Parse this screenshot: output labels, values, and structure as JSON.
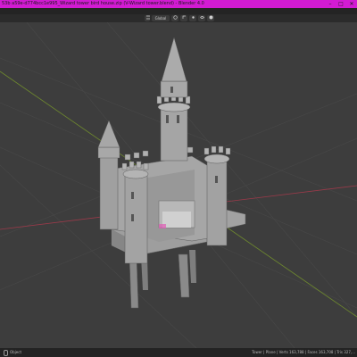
{
  "window": {
    "title": "53b a59e-d774bcc1e995_Wizard tower bird house.zip (V-Wizard tower.blend) - Blender 4.0",
    "controls": [
      "–",
      "□",
      "✕"
    ]
  },
  "header": {
    "view_mode": "Global",
    "icons": [
      "orientation-icon",
      "snap-icon",
      "proportional-icon",
      "overlay-icon",
      "shading-icon"
    ]
  },
  "statusbar": {
    "left": "Object",
    "right": "Tower | Plane | Verts 163,788 | Faces 163,708 | Tris 327,..."
  },
  "colors": {
    "title_bg": "#d21bd2",
    "viewport_bg": "#3d3d3d",
    "grid_line": "#484848",
    "x_axis": "#9b3a4a",
    "y_axis": "#6f8a2e",
    "model": "#9e9e9e"
  }
}
